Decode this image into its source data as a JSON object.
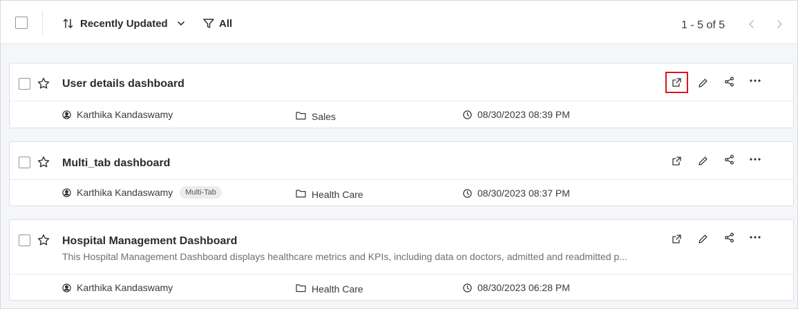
{
  "toolbar": {
    "sort_label": "Recently Updated",
    "filter_label": "All",
    "pager_text": "1 - 5 of 5"
  },
  "cards": [
    {
      "title": "User details dashboard",
      "description": "",
      "owner": "Karthika Kandaswamy",
      "badge": "",
      "category": "Sales",
      "date": "08/30/2023 08:39 PM"
    },
    {
      "title": "Multi_tab dashboard",
      "description": "",
      "owner": "Karthika Kandaswamy",
      "badge": "Multi-Tab",
      "category": "Health Care",
      "date": "08/30/2023 08:37 PM"
    },
    {
      "title": "Hospital Management Dashboard",
      "description": "This Hospital Management Dashboard displays healthcare metrics and KPIs, including data on doctors, admitted and readmitted p...",
      "owner": "Karthika Kandaswamy",
      "badge": "",
      "category": "Health Care",
      "date": "08/30/2023 06:28 PM"
    }
  ],
  "icons": {
    "sort": "sort-icon",
    "chevron": "chevron-down-icon",
    "filter": "filter-icon",
    "star": "star-icon",
    "open": "open-external-icon",
    "edit": "pencil-icon",
    "share": "share-icon",
    "more": "more-icon",
    "user": "user-circle-icon",
    "folder": "folder-icon",
    "clock": "clock-icon"
  },
  "colors": {
    "highlight": "#e0101a"
  }
}
